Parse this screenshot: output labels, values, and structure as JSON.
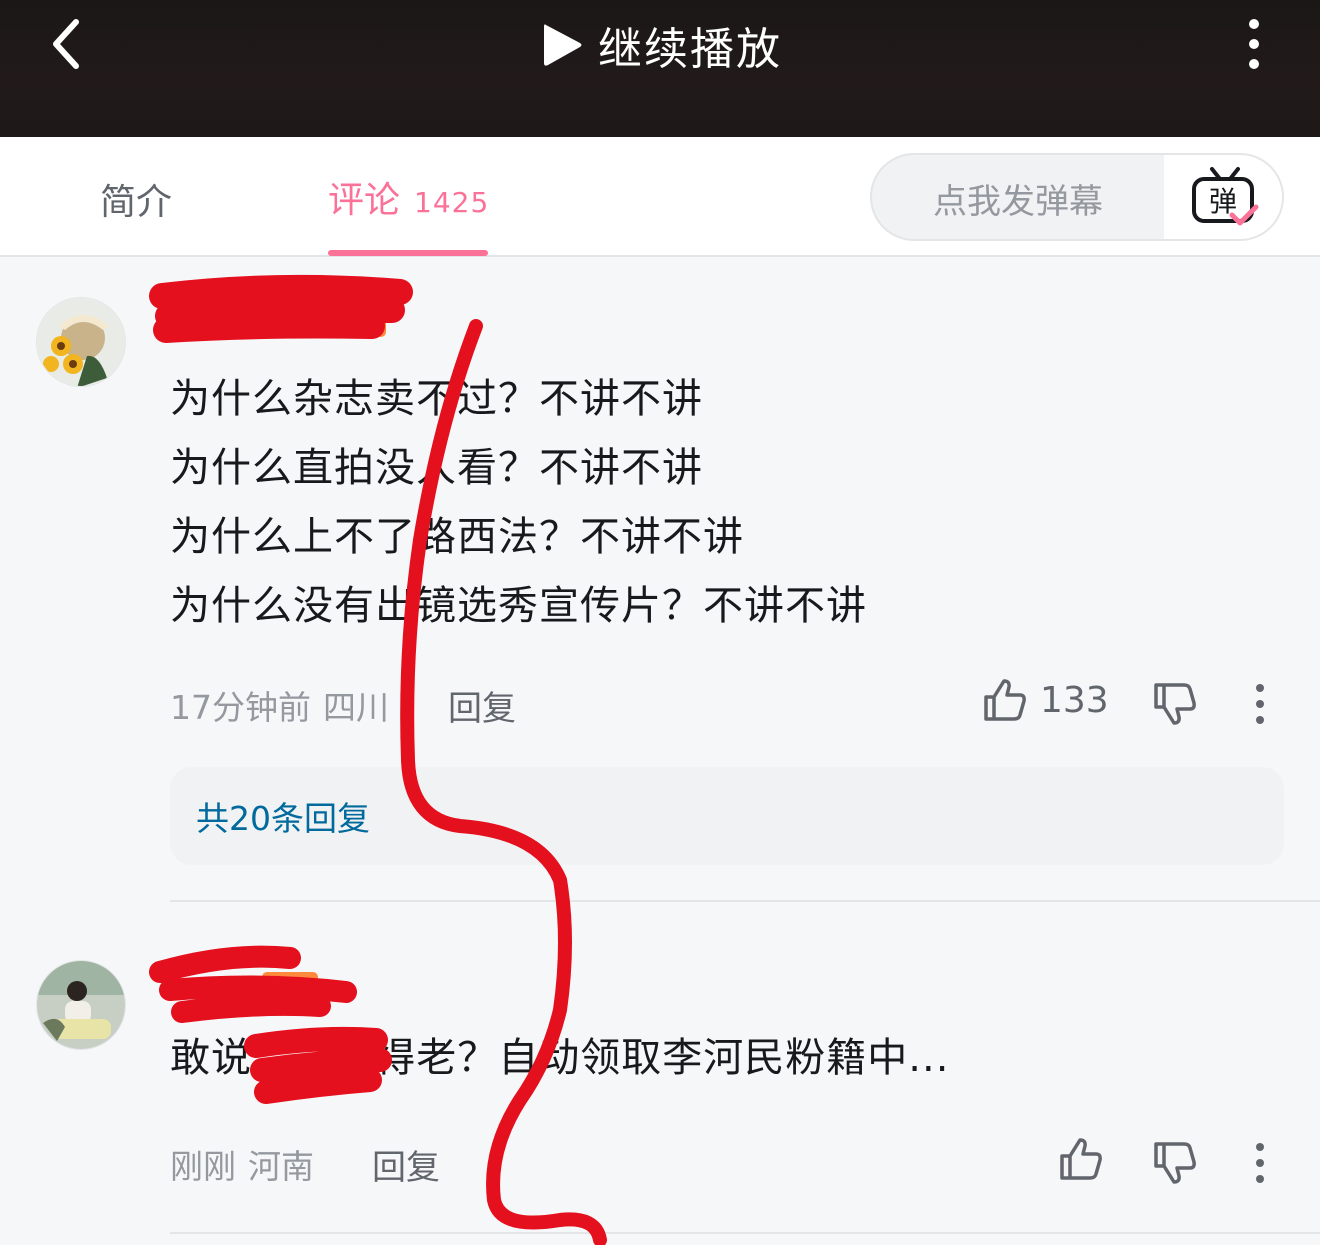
{
  "header": {
    "back_icon": "chevron-left-icon",
    "play_icon": "play-icon",
    "play_label": "继续播放",
    "more_icon": "vertical-dots-icon"
  },
  "tabs": {
    "intro_label": "简介",
    "comments_label": "评论",
    "comments_count": "1425",
    "active": "comments"
  },
  "danmaku": {
    "placeholder": "点我发弹幕",
    "button_icon": "danmaku-tv-icon",
    "button_text": "弹"
  },
  "comments": [
    {
      "avatar_icon": "avatar-image",
      "username": "",
      "content_lines": [
        "为什么杂志卖不过？不讲不讲",
        "为什么直拍没人看？不讲不讲",
        "为什么上不了路西法？不讲不讲",
        "为什么没有出镜选秀宣传片？不讲不讲"
      ],
      "time": "17分钟前",
      "location": "四川",
      "reply_label": "回复",
      "like_count": "133",
      "replies_summary": "共20条回复"
    },
    {
      "avatar_icon": "avatar-image",
      "username": "",
      "content_lines": [
        "敢说      长得老？自动领取李河民粉籍中..."
      ],
      "time": "刚刚",
      "location": "河南",
      "reply_label": "回复",
      "like_count": ""
    }
  ],
  "colors": {
    "accent": "#fb7299",
    "link": "#00699d",
    "redaction": "#e4101d"
  }
}
